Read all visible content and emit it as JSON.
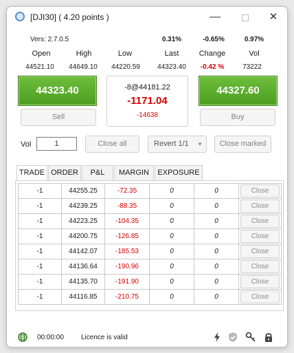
{
  "window": {
    "title": "[DJI30] ( 4.20 points )",
    "minimize": "—",
    "close": "✕"
  },
  "info": {
    "version": "Vers: 2.7.0.5",
    "pct_1": "0.31%",
    "pct_2": "-0.65%",
    "pct_3": "0.97%",
    "headers": {
      "open": "Open",
      "high": "High",
      "low": "Low",
      "last": "Last",
      "change": "Change",
      "vol": "Vol"
    },
    "values": {
      "open": "44521.10",
      "high": "44649.10",
      "low": "44220.59",
      "last": "44323.40",
      "change": "-0.42 %",
      "vol": "73222"
    }
  },
  "trade_panel": {
    "sell_price": "44323.40",
    "buy_price": "44327.60",
    "sell_label": "Sell",
    "buy_label": "Buy",
    "position": "-8@44181.22",
    "pnl": "-1171.04",
    "points": "-14638"
  },
  "controls": {
    "vol_label": "Vol",
    "vol_value": "1",
    "close_all": "Close all",
    "revert": "Revert 1/1",
    "close_marked": "Close marked"
  },
  "tabs": [
    "TRADE",
    "ORDER",
    "P&L",
    "MARGIN",
    "EXPOSURE"
  ],
  "rows": [
    {
      "vol": "-1",
      "price": "44255.25",
      "pl": "-72.35",
      "a": "0",
      "b": "0",
      "close": "Close"
    },
    {
      "vol": "-1",
      "price": "44239.25",
      "pl": "-88.35",
      "a": "0",
      "b": "0",
      "close": "Close"
    },
    {
      "vol": "-1",
      "price": "44223.25",
      "pl": "-104.35",
      "a": "0",
      "b": "0",
      "close": "Close"
    },
    {
      "vol": "-1",
      "price": "44200.75",
      "pl": "-126.85",
      "a": "0",
      "b": "0",
      "close": "Close"
    },
    {
      "vol": "-1",
      "price": "44142.07",
      "pl": "-185.53",
      "a": "0",
      "b": "0",
      "close": "Close"
    },
    {
      "vol": "-1",
      "price": "44136.64",
      "pl": "-190.96",
      "a": "0",
      "b": "0",
      "close": "Close"
    },
    {
      "vol": "-1",
      "price": "44135.70",
      "pl": "-191.90",
      "a": "0",
      "b": "0",
      "close": "Close"
    },
    {
      "vol": "-1",
      "price": "44116.85",
      "pl": "-210.75",
      "a": "0",
      "b": "0",
      "close": "Close"
    }
  ],
  "status": {
    "time": "00:00:00",
    "licence": "Licence is valid"
  },
  "icons": {
    "app": "app-icon",
    "globe": "globe-icon",
    "bolt": "lightning-icon",
    "shield": "shield-icon",
    "key": "key-icon",
    "lock": "lock-icon"
  },
  "colors": {
    "buy_sell_green": "#5aad2c",
    "negative_red": "#d40000"
  }
}
